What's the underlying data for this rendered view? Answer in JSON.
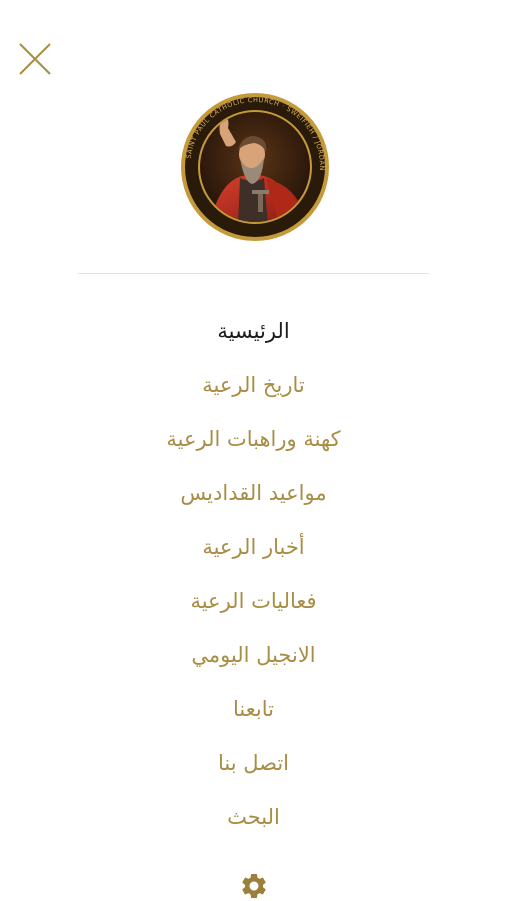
{
  "header": {
    "close_icon": "close-icon"
  },
  "logo": {
    "ring_text": "SAINT PAUL CATHOLIC CHURCH - SWEIFIEH / JORDAN",
    "ring_color": "#2a1a0a",
    "border_color": "#c49a3a"
  },
  "menu": {
    "items": [
      {
        "label": "الرئيسية",
        "active": true
      },
      {
        "label": "تاريخ الرعية"
      },
      {
        "label": "كهنة وراهبات الرعية"
      },
      {
        "label": "مواعيد القداديس"
      },
      {
        "label": "أخبار الرعية"
      },
      {
        "label": "فعاليات الرعية"
      },
      {
        "label": "الانجيل اليومي"
      },
      {
        "label": "تابعنا"
      },
      {
        "label": "اتصل بنا"
      },
      {
        "label": "البحث"
      }
    ]
  },
  "footer": {
    "settings_icon": "gear-icon"
  },
  "colors": {
    "accent": "#a88d45",
    "active_text": "#1c1c1c",
    "icon": "#9b7f3a",
    "divider": "#e2e2e2"
  }
}
